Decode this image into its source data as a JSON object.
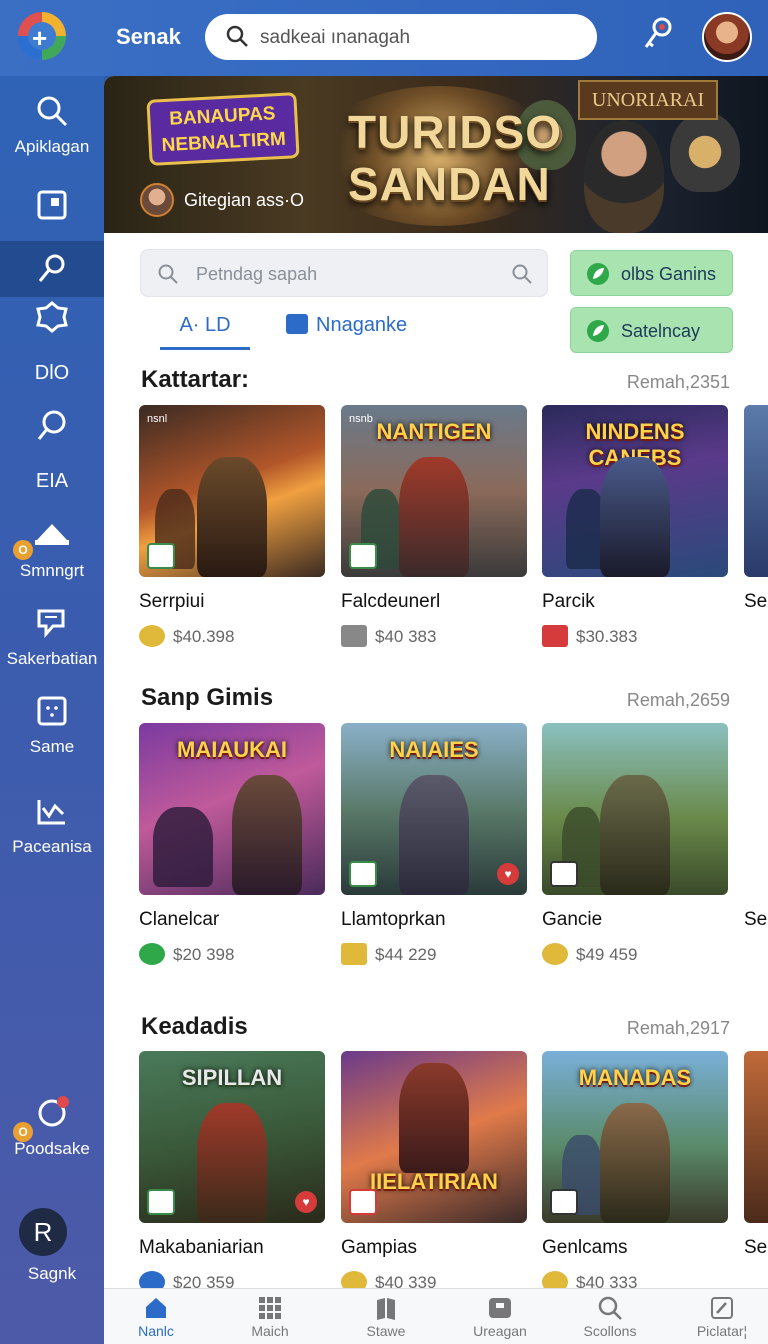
{
  "app": {
    "brand": "Senak"
  },
  "search": {
    "query": "sadkeai ınanagah"
  },
  "sidebar": {
    "items": [
      {
        "label": "Apiklagan",
        "icon": "search-icon"
      },
      {
        "label": "",
        "icon": "window-icon"
      },
      {
        "label": "",
        "icon": "pin-icon",
        "active": true
      },
      {
        "label": "",
        "icon": "badge-icon"
      },
      {
        "label": "DlO",
        "icon": ""
      },
      {
        "label": "",
        "icon": "magnifier-icon"
      },
      {
        "label": "EIA",
        "icon": ""
      },
      {
        "label": "Smnngrt",
        "icon": "hat-icon",
        "badge": "O"
      },
      {
        "label": "Sakerbatian",
        "icon": "chat-icon"
      },
      {
        "label": "Same",
        "icon": "grid-icon"
      },
      {
        "label": "Paceanisa",
        "icon": "chart-icon"
      },
      {
        "label": "Poodsake",
        "icon": "game-icon",
        "badge": "O"
      },
      {
        "label": "Sagnk",
        "icon": "user-icon",
        "avatar_letter": "R"
      }
    ]
  },
  "hero": {
    "badge_text": "BANAUPAS NEBNALTIRM",
    "title_line1": "TURIDSO",
    "title_line2": "SANDAN",
    "sign_text": "UNORIARAI",
    "user_label": "Gitegian ass·O"
  },
  "filter": {
    "placeholder": "Petndag sapah"
  },
  "actions": [
    {
      "label": "olbs Ganins"
    },
    {
      "label": "Satelncay"
    }
  ],
  "tabs": [
    {
      "label": "A· LD",
      "active": true
    },
    {
      "label": "Nnaganke",
      "active": false
    }
  ],
  "sections": [
    {
      "title": "Kattartar:",
      "meta": "Remah,2351",
      "cards": [
        {
          "name": "Serrpiui",
          "price": "$40.398",
          "art": "",
          "tag": "nsnl"
        },
        {
          "name": "Falcdeunerl",
          "price": "$40 383",
          "art": "NANTIGEN",
          "tag": "nsnb"
        },
        {
          "name": "Parcik",
          "price": "$30.383",
          "art": "NINDENS CANEBS",
          "tag": ""
        },
        {
          "name": "Se",
          "price": "",
          "art": "",
          "tag": ""
        }
      ]
    },
    {
      "title": "Sanp Gimis",
      "meta": "Remah,2659",
      "cards": [
        {
          "name": "Clanelcar",
          "price": "$20 398",
          "art": "MAIAUKAI",
          "tag": ""
        },
        {
          "name": "Llamtoprkan",
          "price": "$44 229",
          "art": "NAIAIES",
          "tag": ""
        },
        {
          "name": "Gancie",
          "price": "$49 459",
          "art": "",
          "tag": ""
        },
        {
          "name": "Se",
          "price": "",
          "art": "",
          "tag": ""
        }
      ]
    },
    {
      "title": "Keadadis",
      "meta": "Remah,2917",
      "cards": [
        {
          "name": "Makabaniarian",
          "price": "$20 359",
          "art": "SIPILLAN",
          "tag": ""
        },
        {
          "name": "Gampias",
          "price": "$40 339",
          "art": "IIELATIRIAN",
          "tag": ""
        },
        {
          "name": "Genlcams",
          "price": "$40 333",
          "art": "MANADAS",
          "tag": ""
        },
        {
          "name": "Se",
          "price": "",
          "art": "",
          "tag": ""
        }
      ]
    }
  ],
  "bottom_nav": [
    {
      "label": "Nanlc",
      "icon": "home-icon",
      "active": true
    },
    {
      "label": "Maich",
      "icon": "apps-icon",
      "active": false
    },
    {
      "label": "Stawe",
      "icon": "book-icon",
      "active": false
    },
    {
      "label": "Ureagan",
      "icon": "tray-icon",
      "active": false
    },
    {
      "label": "Scollons",
      "icon": "search-icon",
      "active": false
    },
    {
      "label": "Piclatar¦",
      "icon": "edit-icon",
      "active": false
    }
  ],
  "colors": {
    "accent": "#2c6bc7",
    "sidebar": "#2f63b6",
    "action_green": "#a8e3b0"
  }
}
